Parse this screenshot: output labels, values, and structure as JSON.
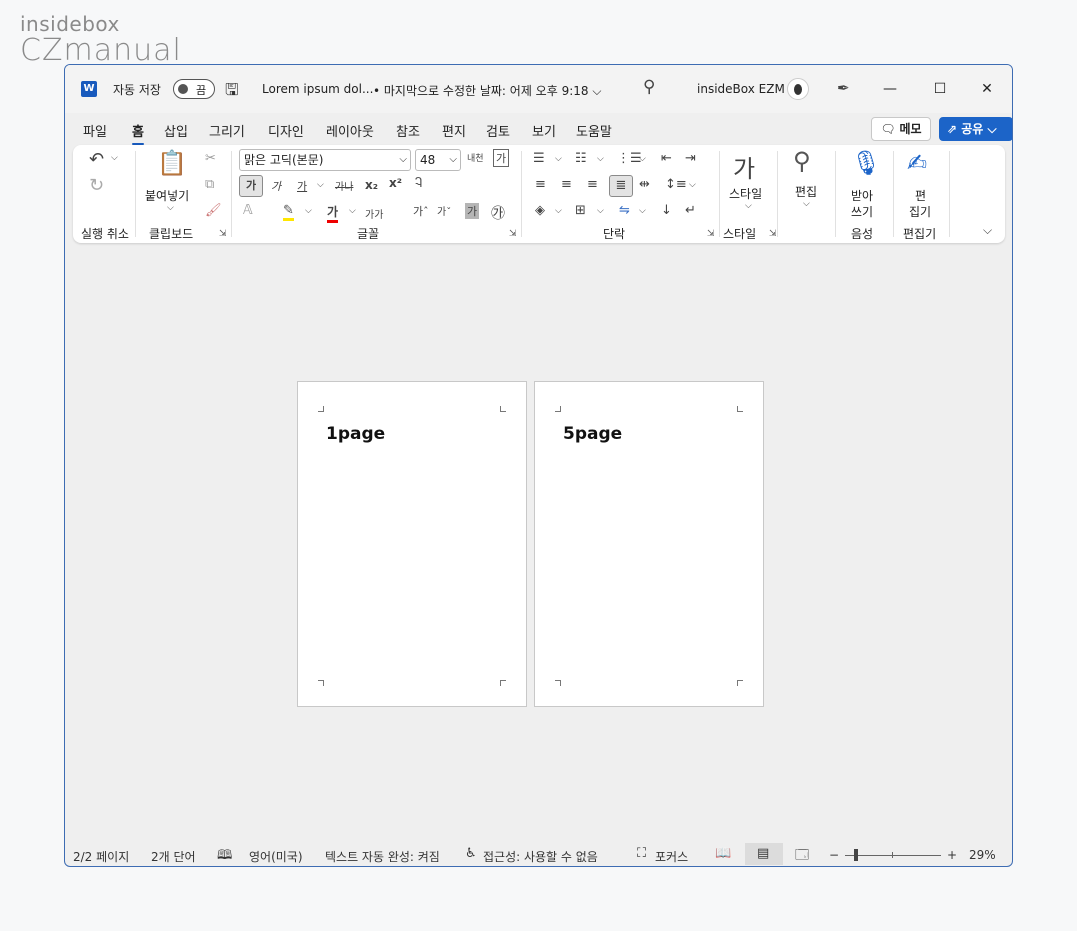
{
  "watermark": {
    "line1": "insidebox",
    "line2": "CZmanual"
  },
  "titlebar": {
    "app_icon": "W",
    "autosave_label": "자동 저장",
    "autosave_state": "끔",
    "doc_title": "Lorem ipsum dol...",
    "doc_meta": "• 마지막으로 수정한 날짜: 어제 오후 9:18 ⌵",
    "username": "insideBox EZM",
    "minimize": "—",
    "maximize": "☐",
    "close": "✕"
  },
  "tabs": [
    "파일",
    "홈",
    "삽입",
    "그리기",
    "디자인",
    "레이아웃",
    "참조",
    "편지",
    "검토",
    "보기",
    "도움말"
  ],
  "active_tab": "홈",
  "memo_label": "메모",
  "share_label": "공유",
  "ribbon": {
    "groups": {
      "undo": "실행 취소",
      "clipboard": "클립보드",
      "font": "글꼴",
      "paragraph": "단락",
      "styles": "스타일",
      "voice": "음성",
      "editor": "편집기"
    },
    "paste_label": "붙여넣기",
    "font_name": "맑은 고딕(본문)",
    "font_size": "48",
    "style_label": "스타일",
    "edit_label": "편집",
    "dictate_label_1": "받아",
    "dictate_label_2": "쓰기",
    "editor_label_1": "편",
    "editor_label_2": "집기",
    "bold_glyph": "가",
    "italic_glyph": "가",
    "underline_glyph": "가",
    "strike_glyph": "가나",
    "sub_glyph": "x₂",
    "sup_glyph": "x²",
    "style_glyph": "가",
    "phonetic_glyph": "내천",
    "charborder_glyph": "가"
  },
  "pages": [
    {
      "text": "1page"
    },
    {
      "text": "5page"
    }
  ],
  "statusbar": {
    "page": "2/2 페이지",
    "words": "2개 단어",
    "language": "영어(미국)",
    "autocomplete": "텍스트 자동 완성: 켜짐",
    "accessibility": "접근성: 사용할 수 없음",
    "focus": "포커스",
    "zoom_minus": "−",
    "zoom_plus": "+",
    "zoom": "29%"
  }
}
